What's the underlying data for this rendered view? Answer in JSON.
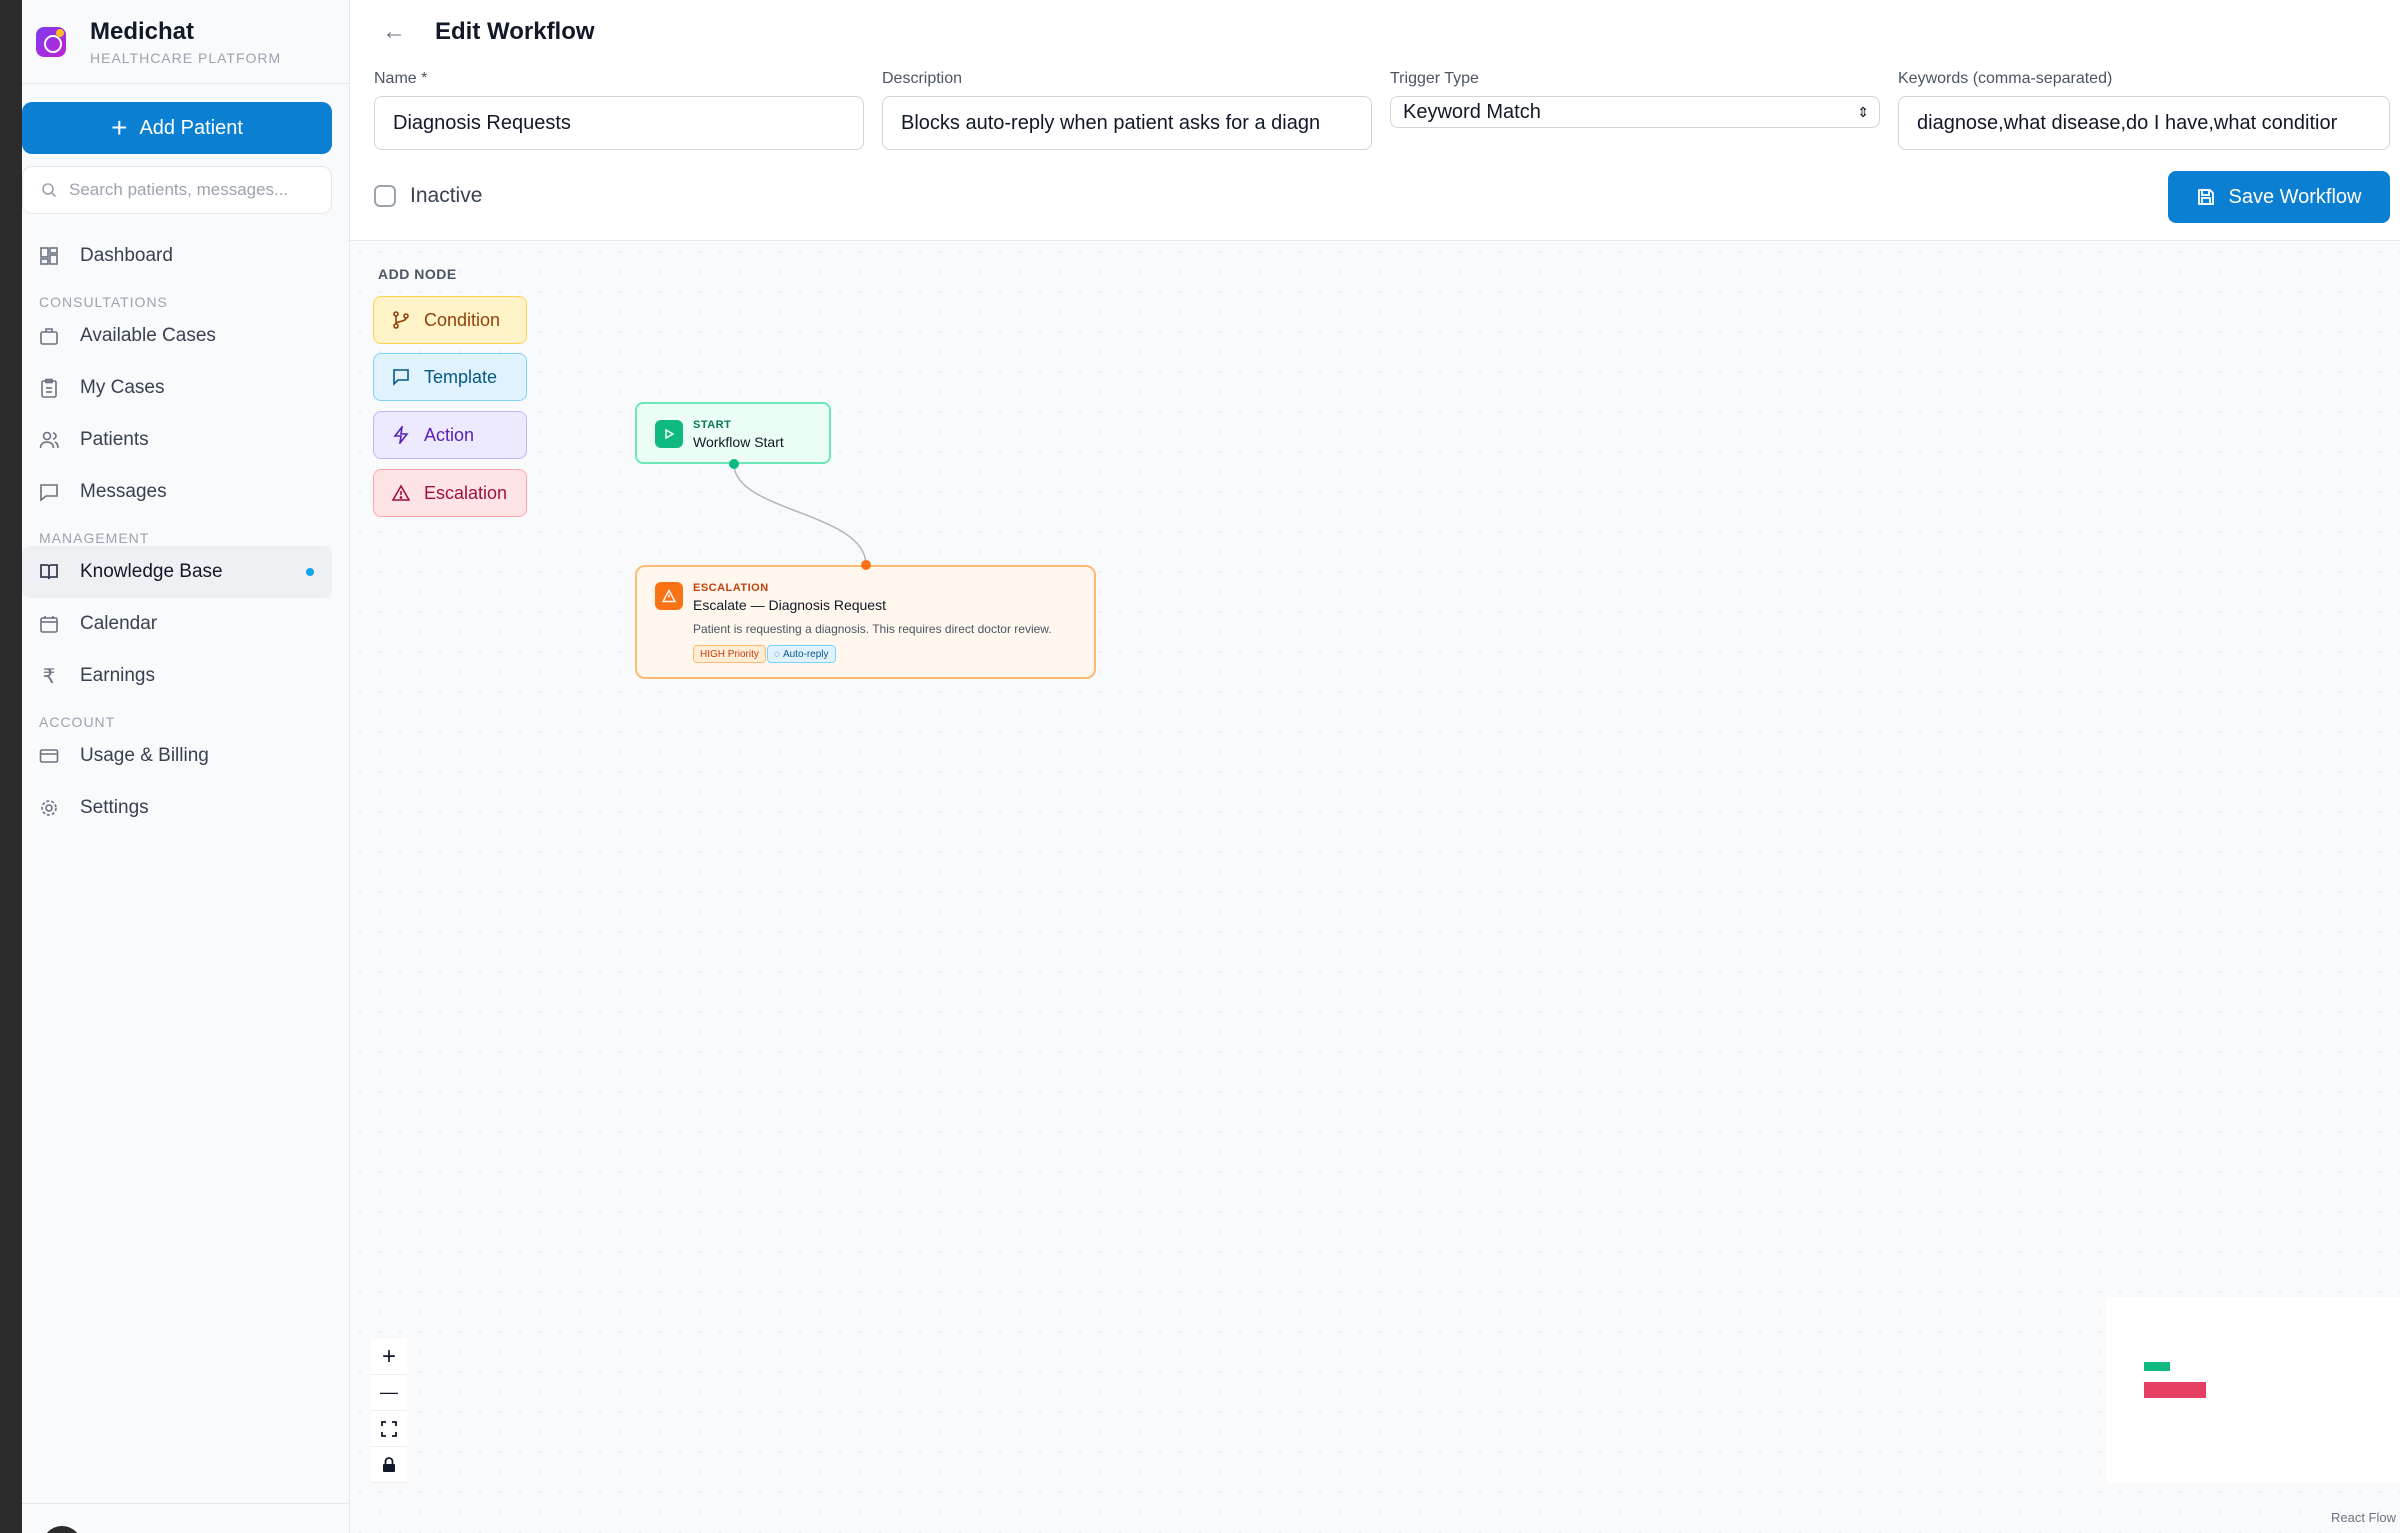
{
  "brand": {
    "name": "Medichat",
    "subtitle": "HEALTHCARE PLATFORM",
    "logo_icon": "chat-bubble-icon"
  },
  "sidebar": {
    "add_patient_label": "Add Patient",
    "search_placeholder": "Search patients, messages...",
    "items": [
      {
        "label": "Dashboard",
        "icon": "dashboard-icon"
      },
      {
        "section": "CONSULTATIONS"
      },
      {
        "label": "Available Cases",
        "icon": "briefcase-icon"
      },
      {
        "label": "My Cases",
        "icon": "clipboard-icon"
      },
      {
        "label": "Patients",
        "icon": "users-icon"
      },
      {
        "label": "Messages",
        "icon": "message-icon"
      },
      {
        "section": "MANAGEMENT"
      },
      {
        "label": "Knowledge Base",
        "icon": "book-icon",
        "active": true
      },
      {
        "label": "Calendar",
        "icon": "calendar-icon"
      },
      {
        "label": "Earnings",
        "icon": "rupee-icon"
      },
      {
        "section": "ACCOUNT"
      },
      {
        "label": "Usage & Billing",
        "icon": "credit-card-icon"
      },
      {
        "label": "Settings",
        "icon": "gear-icon"
      }
    ]
  },
  "header": {
    "title": "Edit Workflow",
    "name": {
      "label": "Name *",
      "value": "Diagnosis Requests"
    },
    "description": {
      "label": "Description",
      "value": "Blocks auto-reply when patient asks for a diagn"
    },
    "trigger": {
      "label": "Trigger Type",
      "value": "Keyword Match"
    },
    "keywords": {
      "label": "Keywords (comma-separated)",
      "value": "diagnose,what disease,do I have,what conditior"
    },
    "inactive_label": "Inactive",
    "save_label": "Save Workflow"
  },
  "canvas": {
    "add_node_label": "ADD NODE",
    "palette": [
      "Condition",
      "Template",
      "Action",
      "Escalation"
    ],
    "nodes": {
      "start": {
        "tag": "START",
        "label": "Workflow Start"
      },
      "escalation": {
        "tag": "ESCALATION",
        "label": "Escalate — Diagnosis Request",
        "description": "Patient is requesting a diagnosis. This requires direct doctor review.",
        "priority_badge": "HIGH Priority",
        "autoreply_badge": "Auto-reply"
      }
    },
    "controls": {
      "zoom_in": "+",
      "zoom_out": "—"
    },
    "attribution": "React Flow"
  },
  "colors": {
    "accent": "#0b7fd1",
    "start_node": "#10b981",
    "escalation_node": "#f97316",
    "minimap_start": "#10b981",
    "minimap_escalation": "#e11d48"
  }
}
